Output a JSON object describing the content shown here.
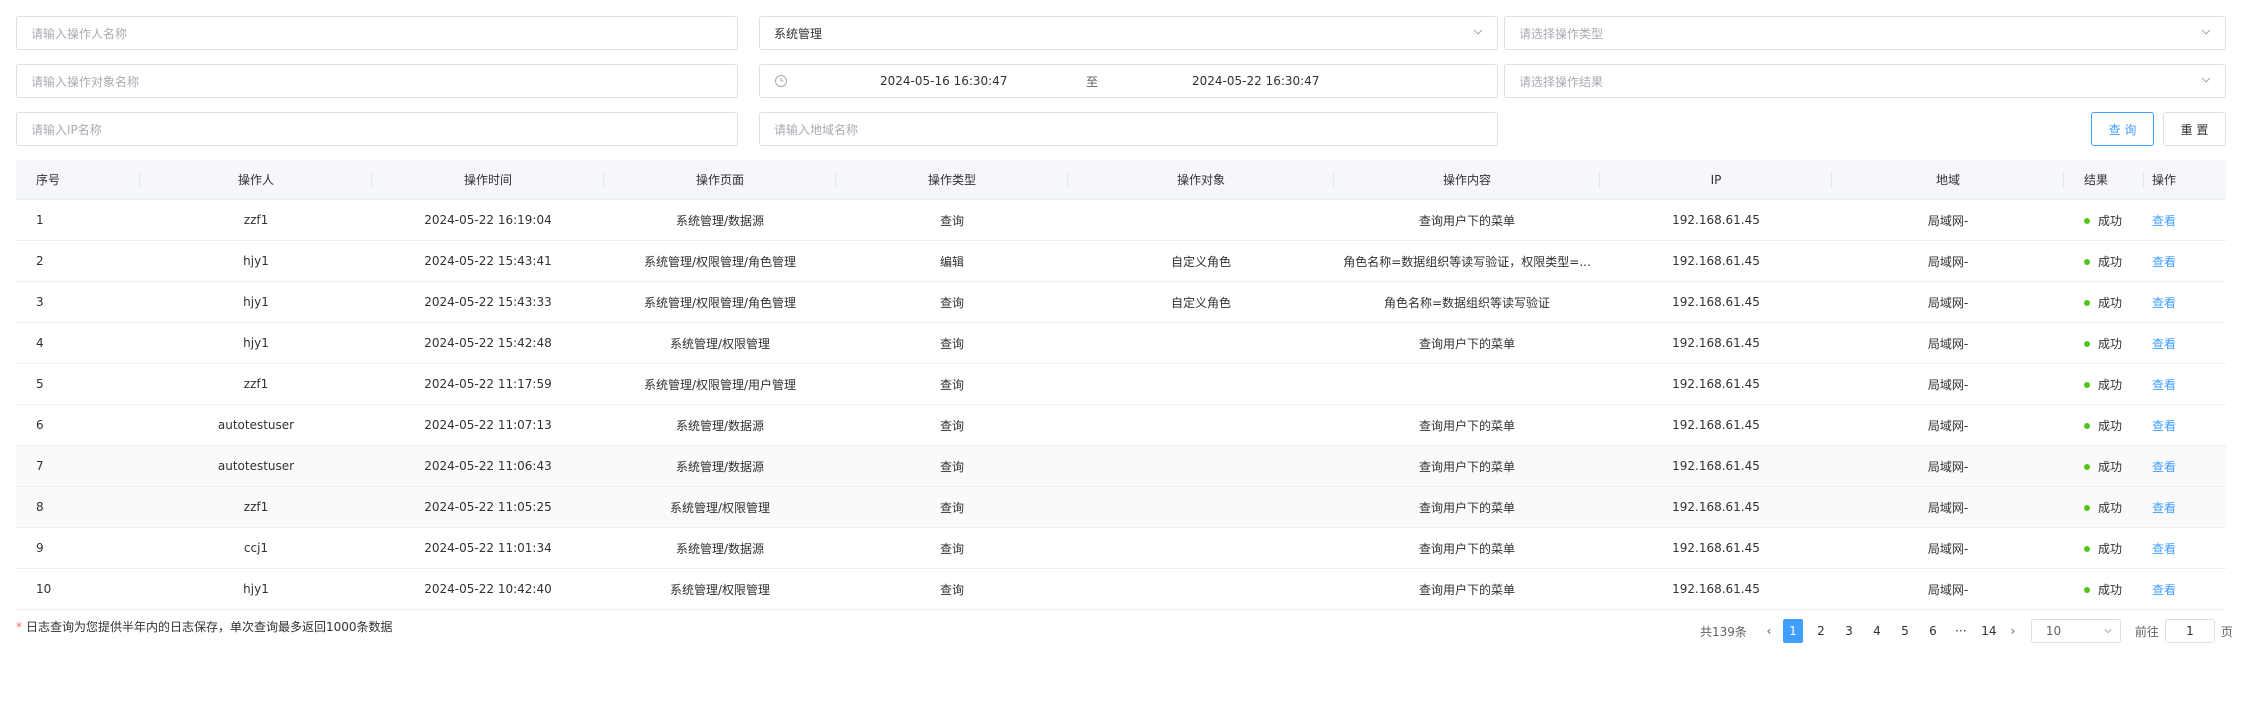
{
  "filters": {
    "operator_name_placeholder": "请输入操作人名称",
    "module_value": "系统管理",
    "op_type_placeholder": "请选择操作类型",
    "target_name_placeholder": "请输入操作对象名称",
    "date_start": "2024-05-16 16:30:47",
    "date_sep": "至",
    "date_end": "2024-05-22 16:30:47",
    "result_placeholder": "请选择操作结果",
    "ip_placeholder": "请输入IP名称",
    "region_placeholder": "请输入地域名称",
    "query_label": "查 询",
    "reset_label": "重 置"
  },
  "table": {
    "headers": [
      "序号",
      "操作人",
      "操作时间",
      "操作页面",
      "操作类型",
      "操作对象",
      "操作内容",
      "IP",
      "地域",
      "结果",
      "操作"
    ],
    "rows": [
      [
        "1",
        "zzf1",
        "2024-05-22 16:19:04",
        "系统管理/数据源",
        "查询",
        "",
        "查询用户下的菜单",
        "192.168.61.45",
        "局域网-",
        "成功",
        "查看"
      ],
      [
        "2",
        "hjy1",
        "2024-05-22 15:43:41",
        "系统管理/权限管理/角色管理",
        "编辑",
        "自定义角色",
        "角色名称=数据组织等读写验证，权限类型=...",
        "192.168.61.45",
        "局域网-",
        "成功",
        "查看"
      ],
      [
        "3",
        "hjy1",
        "2024-05-22 15:43:33",
        "系统管理/权限管理/角色管理",
        "查询",
        "自定义角色",
        "角色名称=数据组织等读写验证",
        "192.168.61.45",
        "局域网-",
        "成功",
        "查看"
      ],
      [
        "4",
        "hjy1",
        "2024-05-22 15:42:48",
        "系统管理/权限管理",
        "查询",
        "",
        "查询用户下的菜单",
        "192.168.61.45",
        "局域网-",
        "成功",
        "查看"
      ],
      [
        "5",
        "zzf1",
        "2024-05-22 11:17:59",
        "系统管理/权限管理/用户管理",
        "查询",
        "",
        "",
        "192.168.61.45",
        "局域网-",
        "成功",
        "查看"
      ],
      [
        "6",
        "autotestuser",
        "2024-05-22 11:07:13",
        "系统管理/数据源",
        "查询",
        "",
        "查询用户下的菜单",
        "192.168.61.45",
        "局域网-",
        "成功",
        "查看"
      ],
      [
        "7",
        "autotestuser",
        "2024-05-22 11:06:43",
        "系统管理/数据源",
        "查询",
        "",
        "查询用户下的菜单",
        "192.168.61.45",
        "局域网-",
        "成功",
        "查看"
      ],
      [
        "8",
        "zzf1",
        "2024-05-22 11:05:25",
        "系统管理/权限管理",
        "查询",
        "",
        "查询用户下的菜单",
        "192.168.61.45",
        "局域网-",
        "成功",
        "查看"
      ],
      [
        "9",
        "ccj1",
        "2024-05-22 11:01:34",
        "系统管理/数据源",
        "查询",
        "",
        "查询用户下的菜单",
        "192.168.61.45",
        "局域网-",
        "成功",
        "查看"
      ],
      [
        "10",
        "hjy1",
        "2024-05-22 10:42:40",
        "系统管理/权限管理",
        "查询",
        "",
        "查询用户下的菜单",
        "192.168.61.45",
        "局域网-",
        "成功",
        "查看"
      ]
    ]
  },
  "note": {
    "star": "*",
    "text": "日志查询为您提供半年内的日志保存，单次查询最多返回1000条数据"
  },
  "pagination": {
    "total": "共139条",
    "pages": [
      "1",
      "2",
      "3",
      "4",
      "5",
      "6",
      "···",
      "14"
    ],
    "active_page": "1",
    "page_size": "10",
    "goto_label": "前往",
    "goto_value": "1",
    "page_suffix": "页"
  },
  "colors": {
    "accent": "#409eff",
    "success": "#52c41a",
    "border": "#dcdfe6"
  }
}
